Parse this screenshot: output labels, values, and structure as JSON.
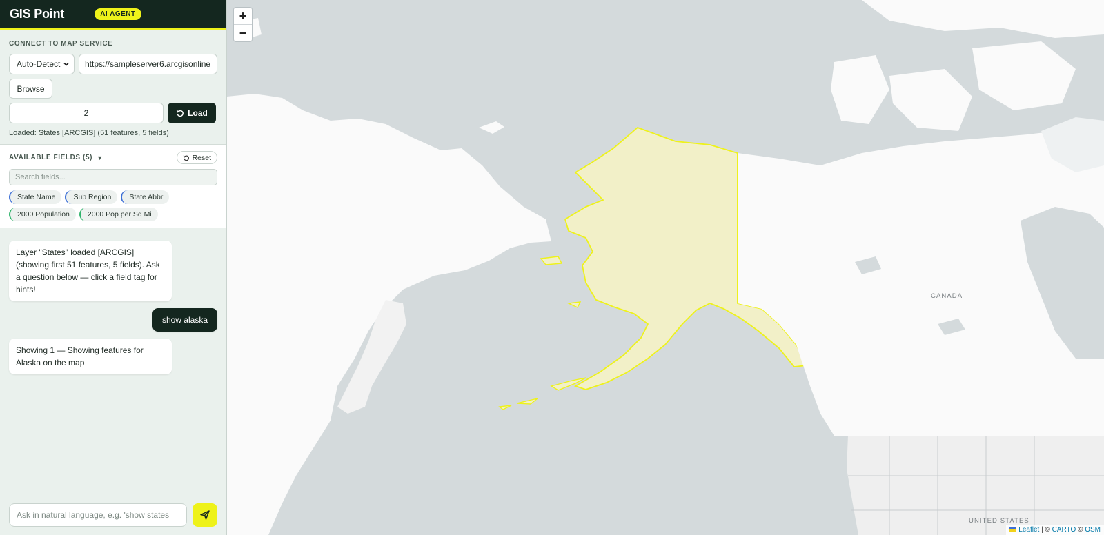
{
  "app": {
    "title": "GIS Point",
    "badge": "AI AGENT"
  },
  "connect": {
    "section_label": "CONNECT TO MAP SERVICE",
    "service_type": "Auto-Detect",
    "url_value": "https://sampleserver6.arcgisonline",
    "browse_label": "Browse",
    "layer_index": "2",
    "load_label": "Load",
    "status": "Loaded: States [ARCGIS] (51 features, 5 fields)"
  },
  "fields": {
    "section_label": "AVAILABLE FIELDS (5)",
    "reset_label": "Reset",
    "search_placeholder": "Search fields...",
    "tags": [
      {
        "label": "State Name",
        "kind": "text"
      },
      {
        "label": "Sub Region",
        "kind": "text"
      },
      {
        "label": "State Abbr",
        "kind": "text"
      },
      {
        "label": "2000 Population",
        "kind": "number"
      },
      {
        "label": "2000 Pop per Sq Mi",
        "kind": "number"
      }
    ]
  },
  "chat": {
    "messages": [
      {
        "role": "assistant",
        "text": "Layer \"States\" loaded [ARCGIS] (showing first 51 features, 5 fields). Ask a question below — click a field tag for hints!"
      },
      {
        "role": "user",
        "text": "show alaska"
      },
      {
        "role": "assistant",
        "text": "Showing 1 — Showing features for Alaska on the map"
      }
    ]
  },
  "composer": {
    "placeholder": "Ask in natural language, e.g. 'show states"
  },
  "map": {
    "zoom_in": "+",
    "zoom_out": "−",
    "labels": {
      "canada": "CANADA",
      "united_states": "UNITED STATES"
    },
    "attribution": {
      "leaflet": "Leaflet",
      "carto": "CARTO",
      "osm": "OSM",
      "separator": "|",
      "copyright": "©"
    },
    "highlight_color": "#eef21a",
    "water_color": "#d4dadc",
    "land_color": "#fafafa"
  }
}
